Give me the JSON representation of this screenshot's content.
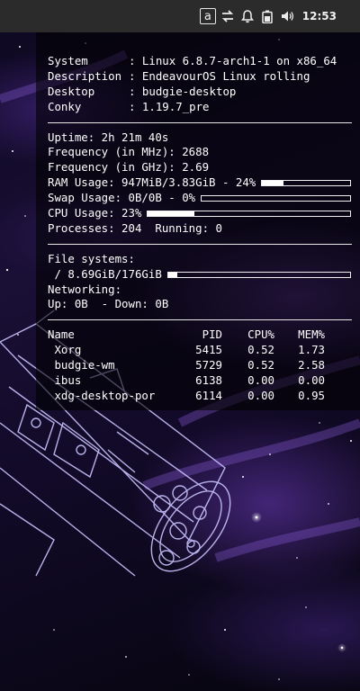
{
  "panel": {
    "app_badge": "a",
    "clock": "12:53",
    "icons": [
      "app-badge-icon",
      "kde-connect-icon",
      "notification-bell-icon",
      "battery-icon",
      "volume-icon"
    ]
  },
  "conky": {
    "system": [
      {
        "key": "System",
        "value": "Linux 6.8.7-arch1-1 on x86_64"
      },
      {
        "key": "Description",
        "value": "EndeavourOS Linux rolling"
      },
      {
        "key": "Desktop",
        "value": "budgie-desktop"
      },
      {
        "key": "Conky",
        "value": "1.19.7_pre"
      }
    ],
    "uptime": "Uptime: 2h 21m 40s",
    "freq_mhz": "Frequency (in MHz): 2688",
    "freq_ghz": "Frequency (in GHz): 2.69",
    "ram": {
      "label": "RAM Usage: 947MiB/3.83GiB - 24%",
      "percent": 24
    },
    "swap": {
      "label": "Swap Usage: 0B/0B - 0%",
      "percent": 0
    },
    "cpu": {
      "label": "CPU Usage: 23%",
      "percent": 23
    },
    "processes": "Processes: 204  Running: 0",
    "fs_title": "File systems:",
    "fs_root": {
      "label": " / 8.69GiB/176GiB",
      "percent": 5
    },
    "net_title": "Networking:",
    "net": "Up: 0B  - Down: 0B",
    "process_table": {
      "headers": [
        "Name",
        "PID",
        "CPU%",
        "MEM%"
      ],
      "rows": [
        {
          "name": " Xorg",
          "pid": "5415",
          "cpu": "0.52",
          "mem": "1.73"
        },
        {
          "name": " budgie-wm",
          "pid": "5729",
          "cpu": "0.52",
          "mem": "2.58"
        },
        {
          "name": " ibus",
          "pid": "6138",
          "cpu": "0.00",
          "mem": "0.00"
        },
        {
          "name": " xdg-desktop-por",
          "pid": "6114",
          "cpu": "0.00",
          "mem": "0.95"
        }
      ]
    }
  }
}
